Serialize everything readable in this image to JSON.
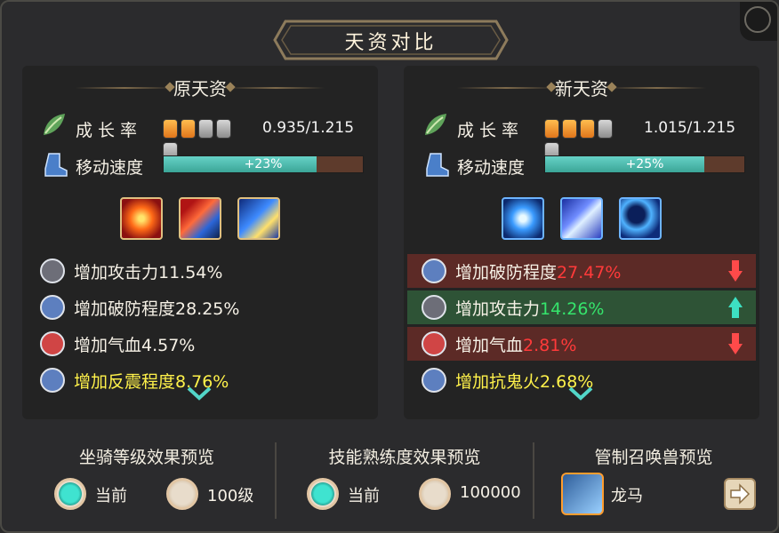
{
  "title": "天资对比",
  "left": {
    "heading": "原天资",
    "growth_label": "成长率",
    "growth_pips_on": 2,
    "growth_pips_total": 5,
    "growth_value": "0.935/1.215",
    "speed_label": "移动速度",
    "speed_fill": 0.77,
    "speed_value": "+23%",
    "skills": [
      "fire-swirl-skill-icon",
      "red-slash-skill-icon",
      "blue-blade-skill-icon"
    ],
    "attrs": [
      {
        "text": "增加攻击力11.54%",
        "icon": "sword-icon"
      },
      {
        "text": "增加破防程度28.25%",
        "icon": "swirl-icon"
      },
      {
        "text": "增加气血4.57%",
        "icon": "heart-icon"
      },
      {
        "text": "增加反震程度8.76%",
        "icon": "swirl-icon"
      }
    ]
  },
  "right": {
    "heading": "新天资",
    "growth_label": "成长率",
    "growth_pips_on": 3,
    "growth_pips_total": 5,
    "growth_value": "1.015/1.215",
    "speed_label": "移动速度",
    "speed_fill": 0.8,
    "speed_value": "+25%",
    "skills": [
      "blue-drop-skill-icon",
      "blue-storm-skill-icon",
      "blue-moon-skill-icon"
    ],
    "attrs": [
      {
        "label": "增加破防程度",
        "value": "27.47%",
        "trend": "down",
        "icon": "swirl-icon"
      },
      {
        "label": "增加攻击力",
        "value": "14.26%",
        "trend": "up",
        "icon": "sword-icon"
      },
      {
        "label": "增加气血",
        "value": "2.81%",
        "trend": "down",
        "icon": "heart-icon"
      },
      {
        "label": "增加抗鬼火2.68%",
        "value": "",
        "trend": "none",
        "icon": "swirl-icon"
      }
    ]
  },
  "bottom": {
    "mount_title": "坐骑等级效果预览",
    "mount_opt1": "当前",
    "mount_opt2": "100级",
    "skill_title": "技能熟练度效果预览",
    "skill_opt1": "当前",
    "skill_opt2": "100000",
    "pet_title": "管制召唤兽预览",
    "pet_name": "龙马"
  },
  "colors": {
    "accent_teal": "#3fe3d0",
    "bad": "#ff3a3a",
    "good": "#35e56c",
    "highlight": "#fff24a"
  }
}
